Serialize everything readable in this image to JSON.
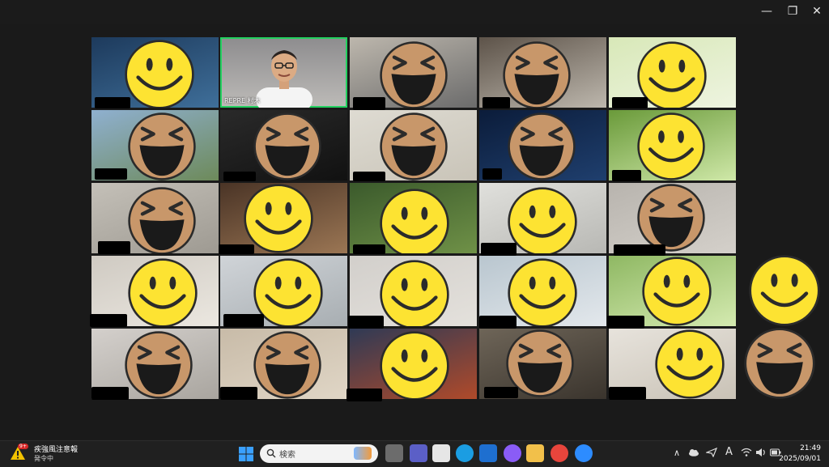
{
  "window": {
    "minimize_glyph": "—",
    "restore_glyph": "❐",
    "close_glyph": "✕"
  },
  "meeting": {
    "active_speaker_name": "REPRE 村木",
    "active_color": "#23d160"
  },
  "taskbar": {
    "weather_badge": "9+",
    "weather_title": "疾強風注意報",
    "weather_subtitle": "発令中",
    "search_placeholder": "検索",
    "apps": [
      "task-view",
      "teams",
      "store",
      "edge",
      "mail",
      "copilot",
      "file-explorer",
      "chrome",
      "zoom"
    ],
    "tray_chevron": "∧",
    "ime_label": "A",
    "time": "21:49",
    "date": "2025/09/01"
  }
}
